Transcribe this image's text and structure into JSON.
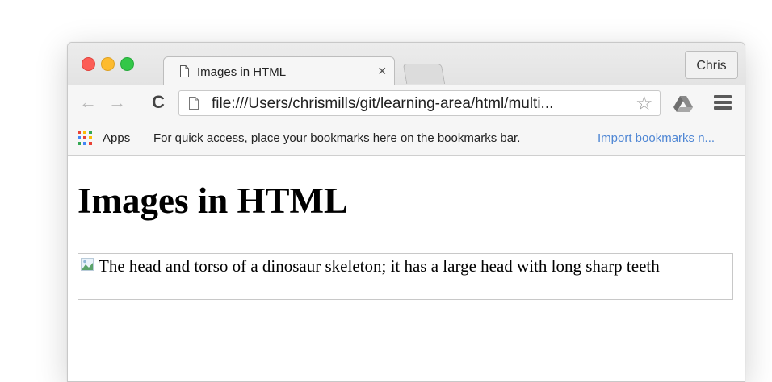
{
  "tab": {
    "title": "Images in HTML",
    "close_glyph": "×"
  },
  "profile": {
    "name": "Chris"
  },
  "toolbar": {
    "back_glyph": "←",
    "forward_glyph": "→",
    "reload_glyph": "C",
    "url": "file:///Users/chrismills/git/learning-area/html/multi...",
    "star_glyph": "☆"
  },
  "bookmarks": {
    "apps_label": "Apps",
    "hint": "For quick access, place your bookmarks here on the bookmarks bar.",
    "import_link": "Import bookmarks n..."
  },
  "page": {
    "heading": "Images in HTML",
    "image_alt": "The head and torso of a dinosaur skeleton; it has a large head with long sharp teeth"
  },
  "colors": {
    "traffic_close": "#fc5d56",
    "traffic_minimize": "#fdbb2f",
    "traffic_maximize": "#33c748",
    "link_blue": "#4e86d4"
  },
  "icons": [
    "page-icon",
    "star-icon",
    "google-drive-icon",
    "menu-icon",
    "apps-icon",
    "broken-image-icon"
  ]
}
